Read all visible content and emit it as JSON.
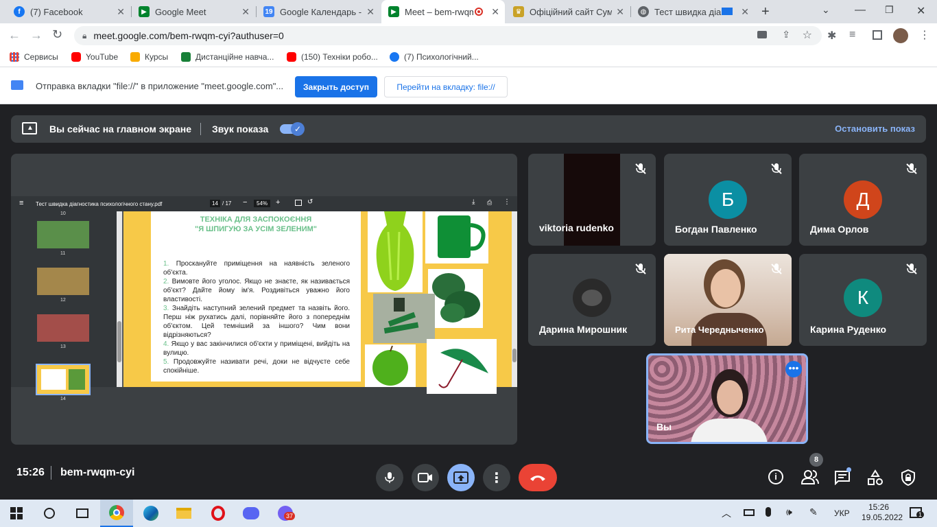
{
  "browser": {
    "tabs": [
      {
        "title": "(7) Facebook",
        "icon": "facebook-icon",
        "color": "#1877f2"
      },
      {
        "title": "Google Meet",
        "icon": "meet-icon",
        "color": "#00832d"
      },
      {
        "title": "Google Календарь - с",
        "icon": "calendar-icon",
        "color": "#4285f4"
      },
      {
        "title": "Meet – bem-rwqm",
        "icon": "meet-icon",
        "color": "#00832d",
        "active": true
      },
      {
        "title": "Офіційний сайт Сумс",
        "icon": "emblem-icon",
        "color": "#c9a227"
      },
      {
        "title": "Тест швидка діаг",
        "icon": "globe-icon",
        "color": "#5f6368"
      }
    ],
    "url": "meet.google.com/bem-rwqm-cyi?authuser=0",
    "bookmarks": [
      {
        "label": "Сервисы",
        "icon": "apps-grid-icon",
        "color": "#ea4335"
      },
      {
        "label": "YouTube",
        "icon": "youtube-icon",
        "color": "#ff0000"
      },
      {
        "label": "Курсы",
        "icon": "classroom-icon",
        "color": "#f9ab00"
      },
      {
        "label": "Дистанційне навча...",
        "icon": "sheets-plus-icon",
        "color": "#188038"
      },
      {
        "label": "(150) Техніки робо...",
        "icon": "youtube-icon",
        "color": "#ff0000"
      },
      {
        "label": "(7) Психологічний...",
        "icon": "facebook-icon",
        "color": "#1877f2"
      }
    ],
    "infobar": {
      "message": "Отправка вкладки \"file://\" в приложение \"meet.google.com\"...",
      "close_access": "Закрыть доступ",
      "go_to_tab": "Перейти на вкладку: file://"
    }
  },
  "meet": {
    "presenting_bar": {
      "label": "Вы сейчас на главном экране",
      "audio_label": "Звук показа",
      "audio_on": true,
      "stop_label": "Остановить показ"
    },
    "pdf": {
      "filename": "Тест швидка діагностика психологічного стану.pdf",
      "page": "14",
      "page_total": "/ 17",
      "zoom": "54%",
      "thumbnails": [
        {
          "num": "10",
          "color": ""
        },
        {
          "num": "11",
          "color": "#5a8f4a"
        },
        {
          "num": "12",
          "color": "#a4874b"
        },
        {
          "num": "13",
          "color": "#a34e4a"
        },
        {
          "num": "14",
          "color": "#f7c948",
          "selected": true
        }
      ],
      "slide": {
        "title_line1": "ТЕХНІКА ДЛЯ ЗАСПОКОЄННЯ",
        "title_line2": "\"Я ШПИГУЮ ЗА УСІМ ЗЕЛЕНИМ\"",
        "items": [
          {
            "n": "1.",
            "text": "Проскануйте приміщення на наявність зеленого об'єкта."
          },
          {
            "n": "2.",
            "text": "Вимовте його уголос. Якщо не знаєте, як називається об'єкт? Дайте йому ім'я. Роздивіться уважно його властивості."
          },
          {
            "n": "3.",
            "text": "Знайдіть наступний зелений предмет та назвіть його. Перш ніж рухатись далі, порівняйте його з попереднім об'єктом. Цей темніший за іншого? Чим вони відрізняються?"
          },
          {
            "n": "4.",
            "text": "Якщо у вас закінчилися об'єкти у приміщені, вийдіть на вулицю."
          },
          {
            "n": "5.",
            "text": "Продовжуйте називати речі, доки не відчуєте себе спокійніше."
          }
        ]
      }
    },
    "participants": [
      {
        "name": "viktoria rudenko",
        "type": "video-dark",
        "muted": true
      },
      {
        "name": "Богдан Павленко",
        "initial": "Б",
        "color": "#0b8fa3",
        "muted": true
      },
      {
        "name": "Дима Орлов",
        "initial": "Д",
        "color": "#d0451b",
        "muted": true
      },
      {
        "name": "Дарина Мирошник",
        "type": "photo-avatar",
        "muted": true
      },
      {
        "name": "Рита Чередныченко",
        "type": "video-light",
        "muted": true
      },
      {
        "name": "Карина Руденко",
        "initial": "К",
        "color": "#0f8a7e",
        "muted": true
      }
    ],
    "self": {
      "name": "Вы"
    },
    "time": "15:26",
    "meeting_code": "bem-rwqm-cyi",
    "people_count": "8"
  },
  "taskbar": {
    "lang": "УКР",
    "time": "15:26",
    "date": "19.05.2022",
    "viber_badge": "37",
    "notif_badge": "1"
  }
}
